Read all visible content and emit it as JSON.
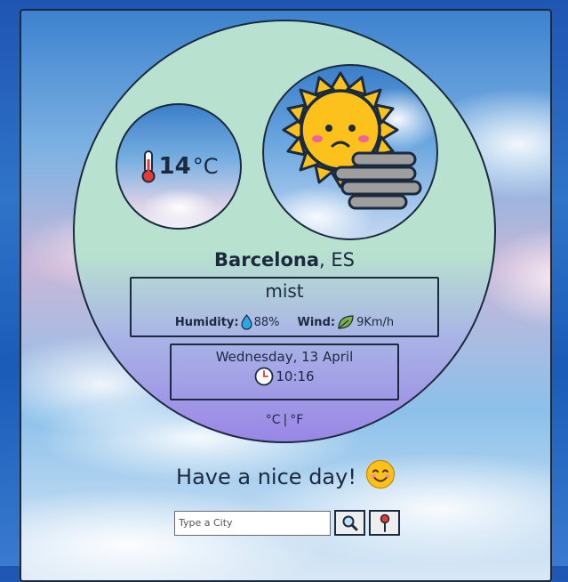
{
  "weather": {
    "temperature": "14",
    "temp_unit": "°C",
    "city": "Barcelona",
    "country": ", ES",
    "description": "mist",
    "humidity_label": "Humidity:",
    "humidity_value": "88%",
    "wind_label": "Wind:",
    "wind_value": "9Km/h",
    "date": "Wednesday, 13 April",
    "time": "10:16",
    "units": {
      "celsius": "°C",
      "separator": "|",
      "fahrenheit": "°F"
    }
  },
  "greeting": {
    "text": "Have a nice day!",
    "emoji": "😊"
  },
  "search": {
    "placeholder": "Type a City",
    "value": ""
  },
  "icons": {
    "thermometer": "thermometer-icon",
    "weather": "sun-mist-icon",
    "humidity": "water-drop-icon",
    "wind": "leaf-icon",
    "clock": "clock-icon",
    "search": "magnifier-icon",
    "location": "pin-icon"
  },
  "colors": {
    "ink": "#1c2a3f",
    "panel_top": "#b8e2cf",
    "panel_bottom": "#9a86e6",
    "sun": "#fcc21b",
    "mist": "#9e9e9e"
  }
}
